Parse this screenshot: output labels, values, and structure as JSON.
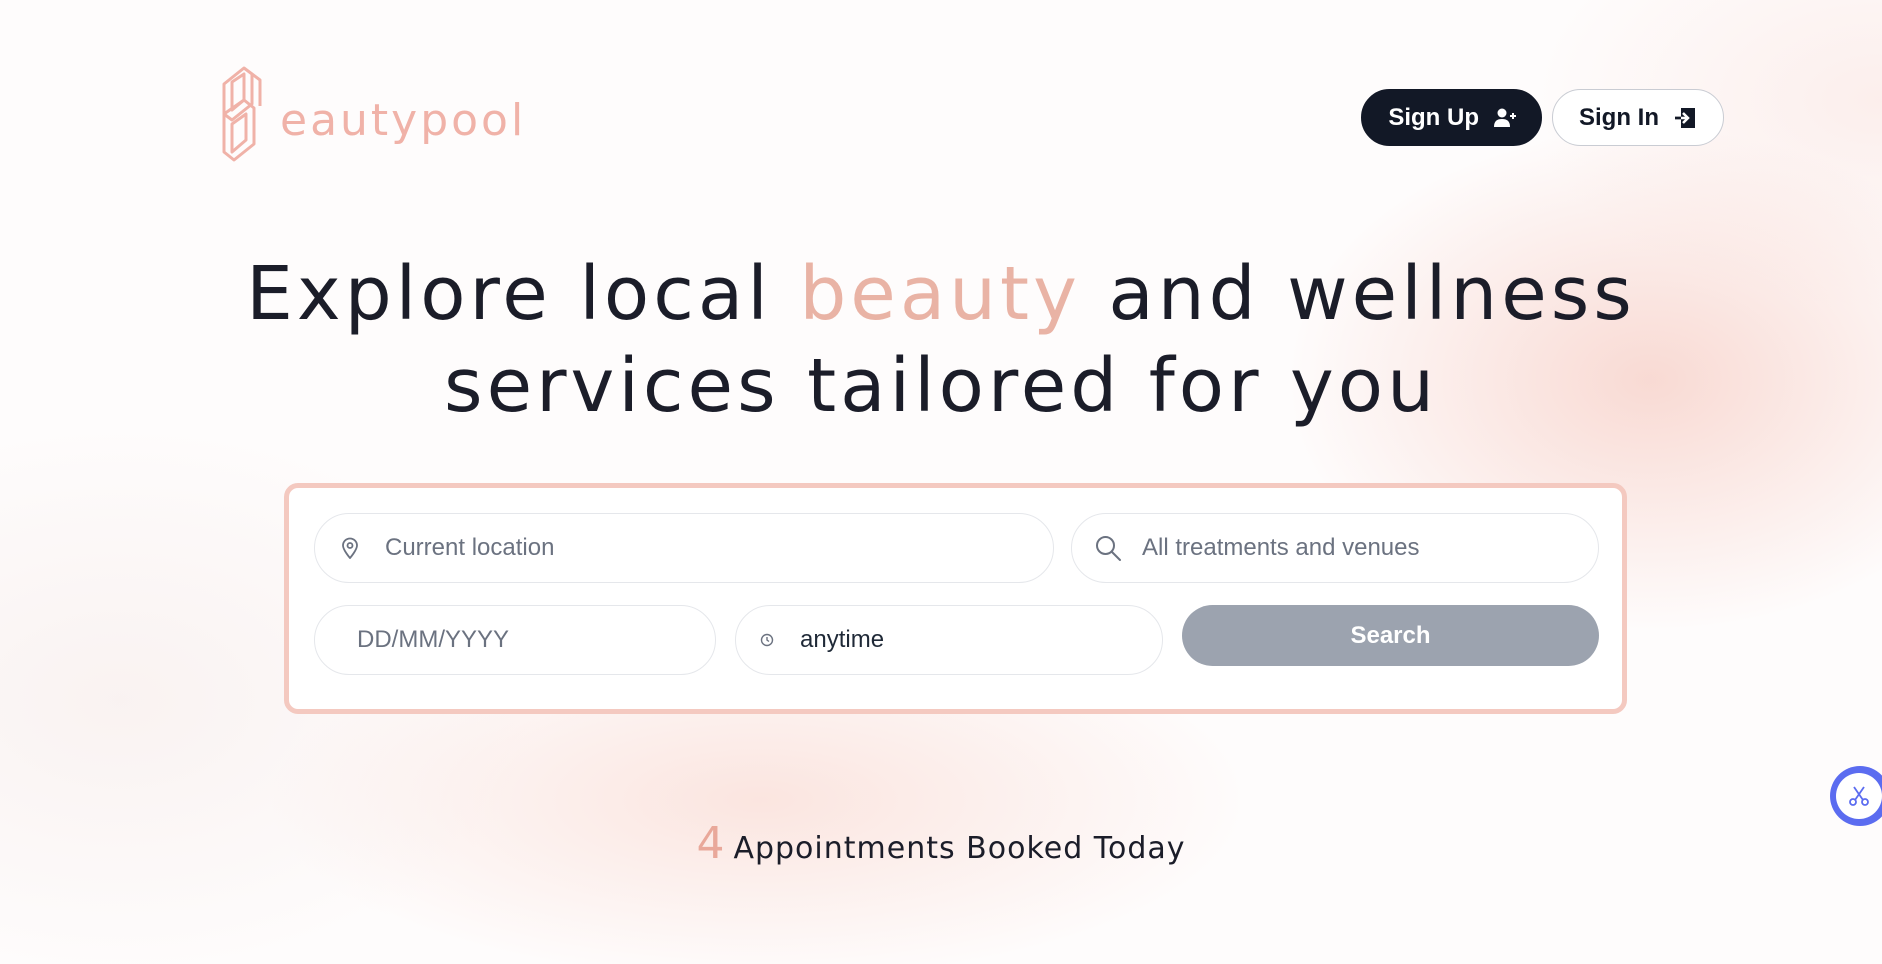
{
  "brand": {
    "logo_text": "eautypool",
    "accent_color": "#f0b2a8"
  },
  "header": {
    "signup_label": "Sign Up",
    "signin_label": "Sign In"
  },
  "hero": {
    "line1_before": "Explore local ",
    "line1_accent": "beauty",
    "line1_after": " and wellness",
    "line2": "services tailored for you"
  },
  "search": {
    "location_placeholder": "Current location",
    "treatments_placeholder": "All treatments and venues",
    "date_placeholder": "DD/MM/YYYY",
    "time_value": "anytime",
    "button_label": "Search"
  },
  "stats": {
    "count": "4",
    "label": "Appointments Booked Today"
  },
  "icons": {
    "location": "map-pin-icon",
    "search": "search-icon",
    "time": "clock-icon",
    "signup": "user-plus-icon",
    "signin": "sign-in-icon",
    "widget": "scissors-icon"
  },
  "colors": {
    "dark": "#121826",
    "button_disabled": "#9ca3af",
    "card_border": "#f4c9c0",
    "widget": "#5b6cf0"
  }
}
